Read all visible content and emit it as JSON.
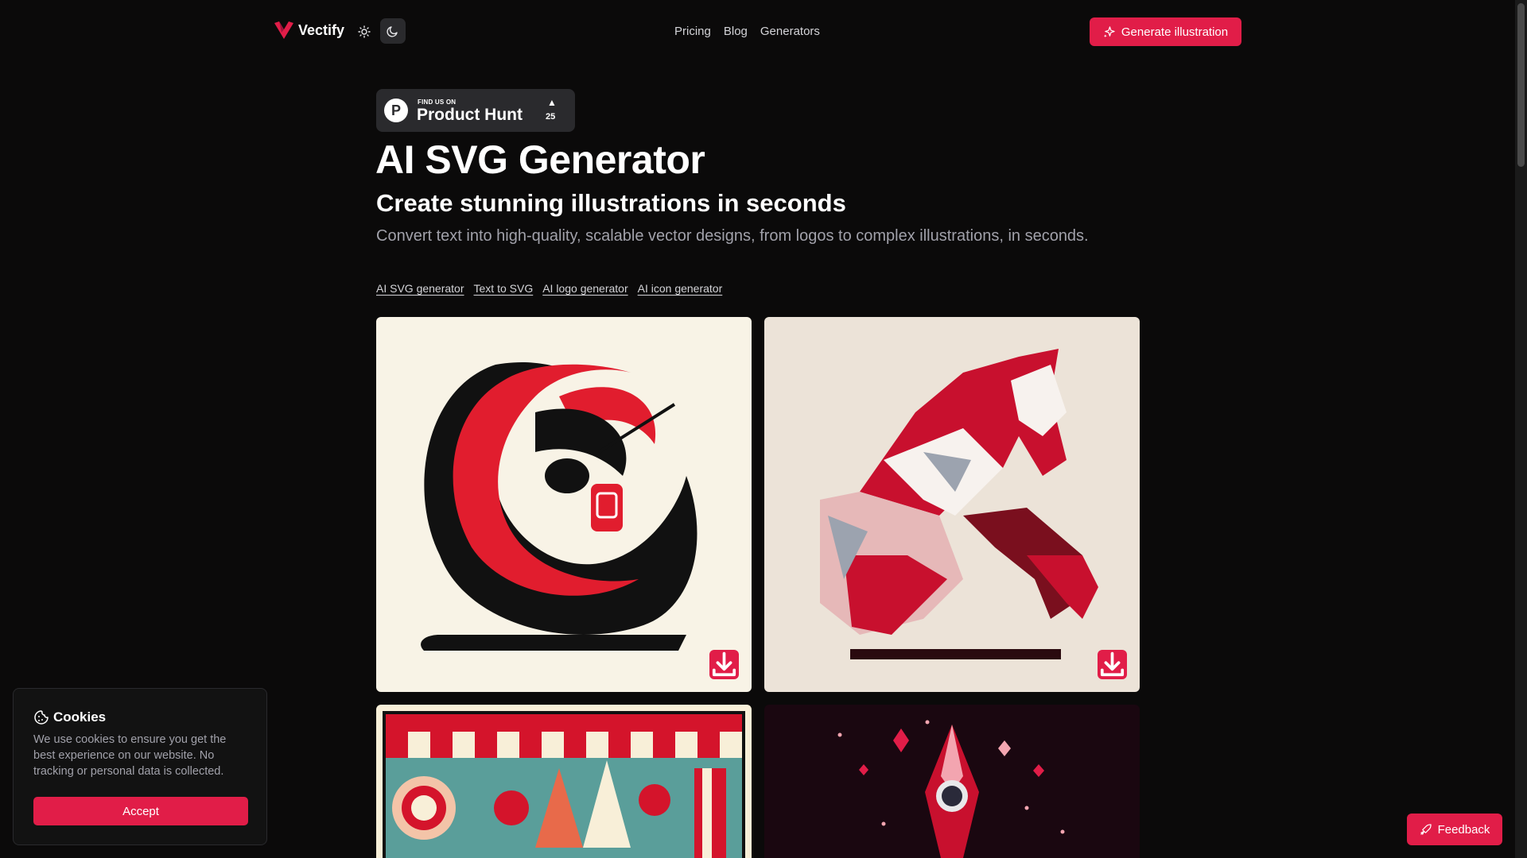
{
  "header": {
    "brand": "Vectify",
    "nav": [
      {
        "label": "Pricing"
      },
      {
        "label": "Blog"
      },
      {
        "label": "Generators"
      }
    ],
    "cta": "Generate illustration",
    "icons": {
      "logo": "vectify-logo-icon",
      "light": "sun-icon",
      "dark": "moon-icon",
      "cta": "sparkle-icon"
    }
  },
  "product_hunt": {
    "small": "FIND US ON",
    "big": "Product Hunt",
    "count": "25",
    "logo_letter": "P"
  },
  "hero": {
    "title": "AI SVG Generator",
    "subtitle": "Create stunning illustrations in seconds",
    "description": "Convert text into high-quality, scalable vector designs, from logos to complex illustrations, in seconds."
  },
  "links": [
    "AI SVG generator",
    "Text to SVG",
    "AI logo generator",
    "AI icon generator"
  ],
  "gallery": [
    {
      "name": "bullfighter-illustration",
      "icon": "download-icon"
    },
    {
      "name": "horse-illustration",
      "icon": "download-icon"
    },
    {
      "name": "candy-pattern-illustration"
    },
    {
      "name": "rocket-illustration"
    }
  ],
  "cookies": {
    "title": "Cookies",
    "text": "We use cookies to ensure you get the best experience on our website. No tracking or personal data is collected.",
    "accept": "Accept",
    "icon": "cookie-icon"
  },
  "feedback": {
    "label": "Feedback",
    "icon": "rocket-icon"
  },
  "colors": {
    "accent": "#e11d48",
    "background": "#0b0a0a",
    "muted": "#a1a1aa"
  }
}
